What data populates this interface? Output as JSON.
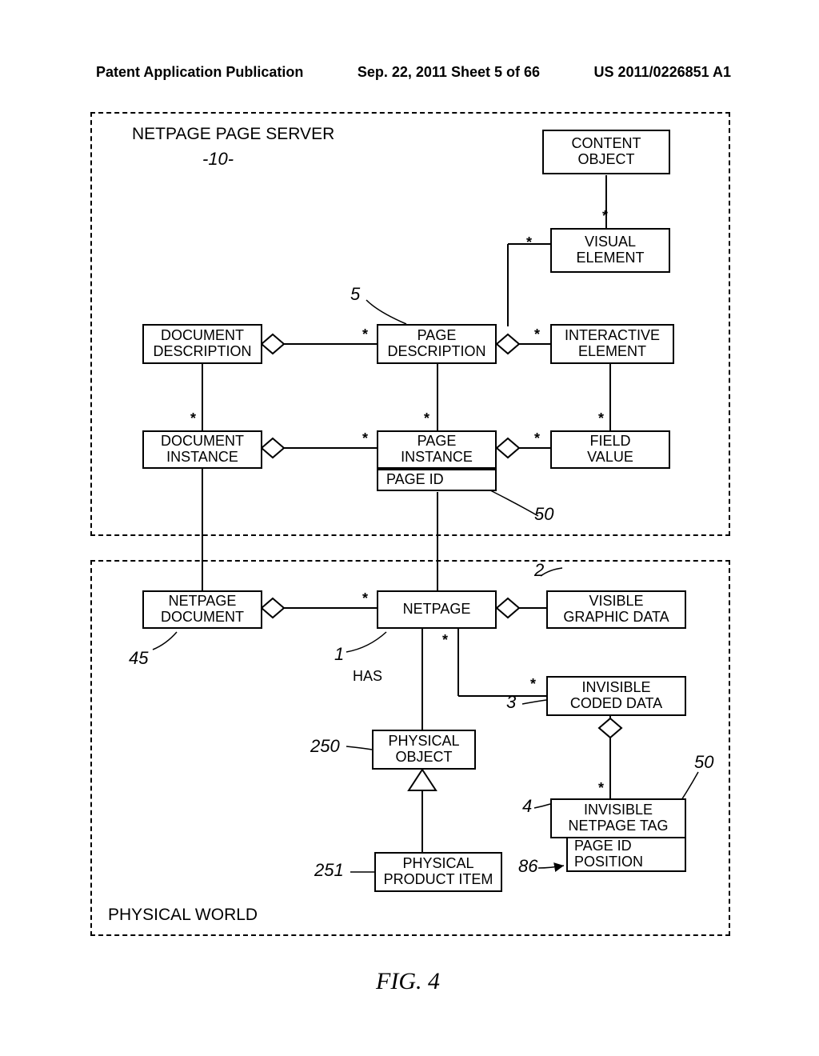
{
  "header": {
    "left": "Patent Application Publication",
    "center": "Sep. 22, 2011  Sheet 5 of 66",
    "right": "US 2011/0226851 A1"
  },
  "serverBox": {
    "title": "NETPAGE PAGE SERVER",
    "ref": "-10-",
    "boxes": {
      "content_object": "CONTENT\nOBJECT",
      "visual_element": "VISUAL\nELEMENT",
      "document_description": "DOCUMENT\nDESCRIPTION",
      "page_description": "PAGE\nDESCRIPTION",
      "interactive_element": "INTERACTIVE\nELEMENT",
      "document_instance": "DOCUMENT\nINSTANCE",
      "page_instance": "PAGE\nINSTANCE",
      "page_instance_sub": "PAGE ID",
      "field_value": "FIELD\nVALUE"
    }
  },
  "worldBox": {
    "title": "PHYSICAL WORLD",
    "boxes": {
      "netpage_document": "NETPAGE\nDOCUMENT",
      "netpage": "NETPAGE",
      "visible_graphic": "VISIBLE\nGRAPHIC DATA",
      "invisible_coded": "INVISIBLE\nCODED DATA",
      "physical_object": "PHYSICAL\nOBJECT",
      "invisible_tag": "INVISIBLE\nNETPAGE TAG",
      "invisible_tag_sub1": "PAGE ID",
      "invisible_tag_sub2": "POSITION",
      "physical_product": "PHYSICAL\nPRODUCT ITEM"
    },
    "has_label": "HAS"
  },
  "refs": {
    "r5": "5",
    "r50a": "50",
    "r2": "2",
    "r45": "45",
    "r1": "1",
    "r3": "3",
    "r250": "250",
    "r50b": "50",
    "r4": "4",
    "r86": "86",
    "r251": "251"
  },
  "figure_label": "FIG. 4"
}
